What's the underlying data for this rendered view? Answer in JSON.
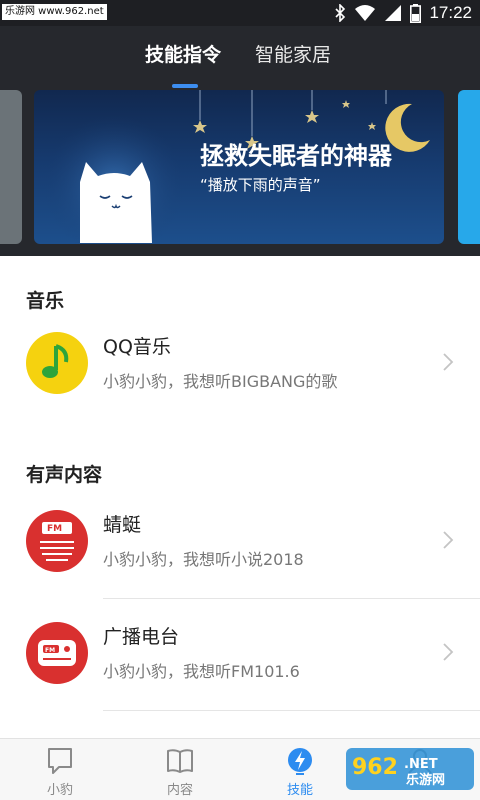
{
  "status_bar": {
    "watermark": "乐游网 www.962.net",
    "time": "17:22",
    "icons": [
      "bluetooth-icon",
      "wifi-icon",
      "signal-icon",
      "battery-icon"
    ]
  },
  "tabs": [
    {
      "label": "技能指令",
      "active": true
    },
    {
      "label": "智能家居",
      "active": false
    }
  ],
  "banner": {
    "title": "拯救失眠者的神器",
    "subtitle": "“播放下雨的声音”"
  },
  "sections": [
    {
      "title": "音乐",
      "items": [
        {
          "name": "QQ音乐",
          "desc": "小豹小豹，我想听BIGBANG的歌",
          "icon": "qq-music-icon"
        }
      ]
    },
    {
      "title": "有声内容",
      "items": [
        {
          "name": "蜻蜓",
          "desc": "小豹小豹，我想听小说2018",
          "icon": "qingting-fm-icon"
        },
        {
          "name": "广播电台",
          "desc": "小豹小豹，我想听FM101.6",
          "icon": "radio-icon"
        }
      ]
    }
  ],
  "bottom_nav": [
    {
      "label": "小豹",
      "icon": "chat-bubble-icon",
      "active": false
    },
    {
      "label": "内容",
      "icon": "book-icon",
      "active": false
    },
    {
      "label": "技能",
      "icon": "lightning-icon",
      "active": true
    },
    {
      "label": "",
      "icon": "profile-icon",
      "active": false
    }
  ],
  "watermark_br": "962.NET 乐游网",
  "colors": {
    "accent": "#2d8cf0",
    "header_bg": "#26282d",
    "qq_music_yellow": "#f5d20f",
    "qq_music_green": "#2ea43b",
    "radio_red": "#d9302f"
  }
}
